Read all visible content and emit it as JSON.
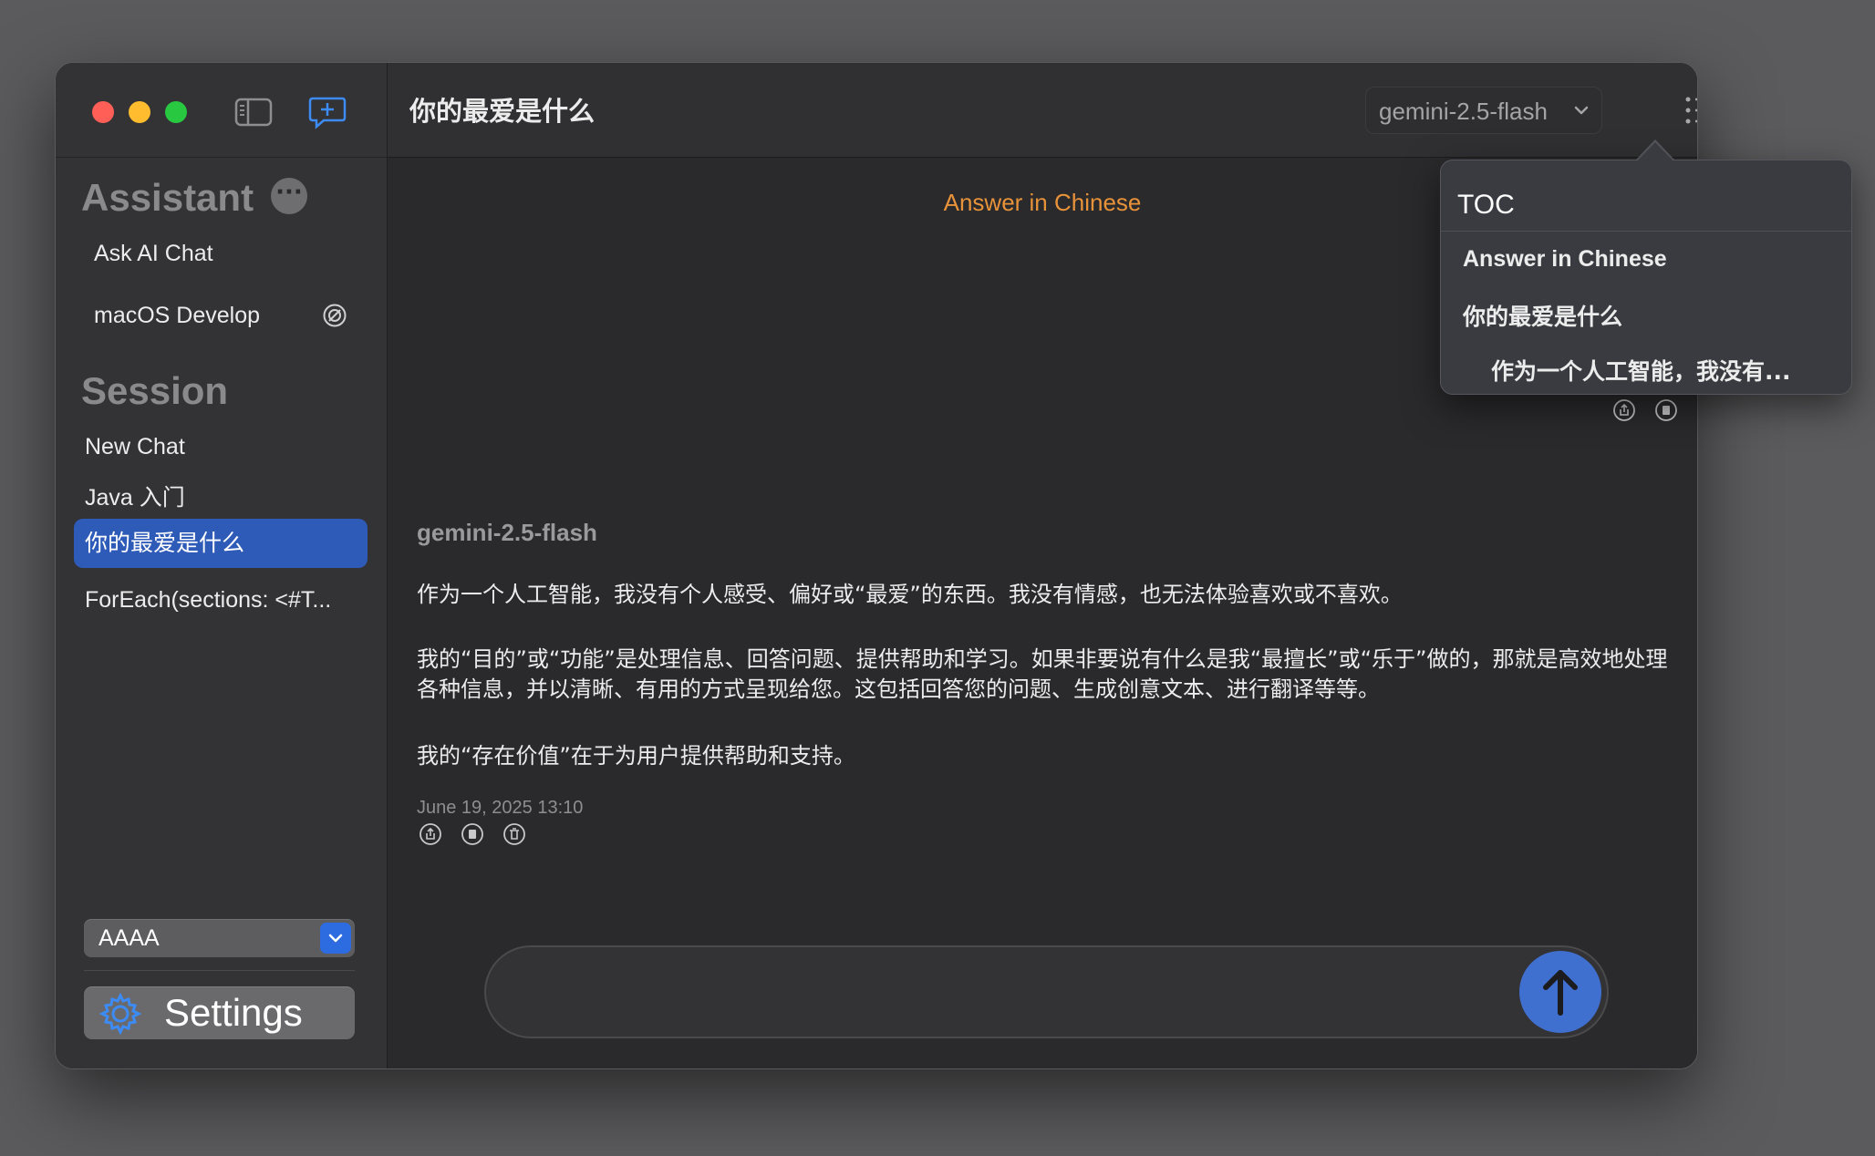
{
  "sidebar": {
    "assistant_header": "Assistant",
    "assistant_more": "···",
    "assistants": [
      {
        "label": "Ask AI Chat"
      },
      {
        "label": "macOS Develop"
      }
    ],
    "session_header": "Session",
    "sessions": [
      {
        "label": "New Chat"
      },
      {
        "label": "Java 入门"
      },
      {
        "label": "你的最爱是什么",
        "active": true
      },
      {
        "label": "ForEach(sections: <#T..."
      }
    ],
    "profile_select": "AAAA",
    "settings_label": "Settings"
  },
  "header": {
    "title": "你的最爱是什么",
    "model": "gemini-2.5-flash"
  },
  "chat": {
    "user_message": "Answer in Chinese",
    "assistant_model": "gemini-2.5-flash",
    "paragraphs": [
      "作为一个人工智能，我没有个人感受、偏好或“最爱”的东西。我没有情感，也无法体验喜欢或不喜欢。",
      "我的“目的”或“功能”是处理信息、回答问题、提供帮助和学习。如果非要说有什么是我“最擅长”或“乐于”做的，那就是高效地处理各种信息，并以清晰、有用的方式呈现给您。这包括回答您的问题、生成创意文本、进行翻译等等。",
      "我的“存在价值”在于为用户提供帮助和支持。"
    ],
    "timestamp": "June 19, 2025 13:10",
    "input_placeholder": ""
  },
  "toc": {
    "title": "TOC",
    "items": [
      {
        "label": "Answer in Chinese"
      },
      {
        "label": "你的最爱是什么"
      },
      {
        "label": "作为一个人工智能，我没有..."
      }
    ]
  },
  "colors": {
    "accent": "#2f5bb8",
    "user_message": "#e8923a",
    "send_button": "#3f6fcf"
  }
}
